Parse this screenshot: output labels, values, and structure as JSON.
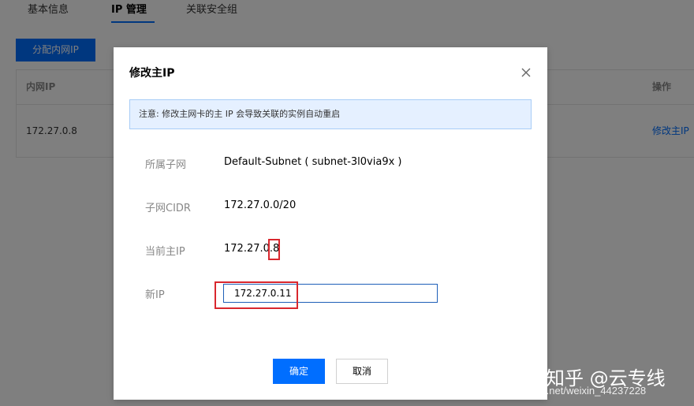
{
  "tabs": [
    {
      "label": "基本信息"
    },
    {
      "label": "IP 管理"
    },
    {
      "label": "关联安全组"
    }
  ],
  "toolbar": {
    "assign_label": "分配内网IP"
  },
  "table": {
    "headers": {
      "private_ip": "内网IP",
      "actions": "操作"
    },
    "rows": [
      {
        "private_ip": "172.27.0.8",
        "action": "修改主IP"
      }
    ]
  },
  "modal": {
    "title": "修改主IP",
    "notice": "注意: 修改主网卡的主 IP 会导致关联的实例自动重启",
    "fields": {
      "subnet": {
        "label": "所属子网",
        "value": "Default-Subnet ( subnet-3l0via9x )"
      },
      "cidr": {
        "label": "子网CIDR",
        "value": "172.27.0.0/20"
      },
      "current_ip": {
        "label": "当前主IP",
        "value": "172.27.0.8"
      },
      "new_ip": {
        "label": "新IP",
        "value": "172.27.0.11"
      }
    },
    "confirm_label": "确定",
    "cancel_label": "取消"
  },
  "watermark": {
    "zhihu": "知乎 @云专线",
    "url": "https://blog.csdn.net/weixin_44237228"
  },
  "colors": {
    "primary": "#006eff",
    "highlight": "#d9272e",
    "notice_bg": "#e5f0ff"
  },
  "icons": {
    "close": "close-icon"
  }
}
